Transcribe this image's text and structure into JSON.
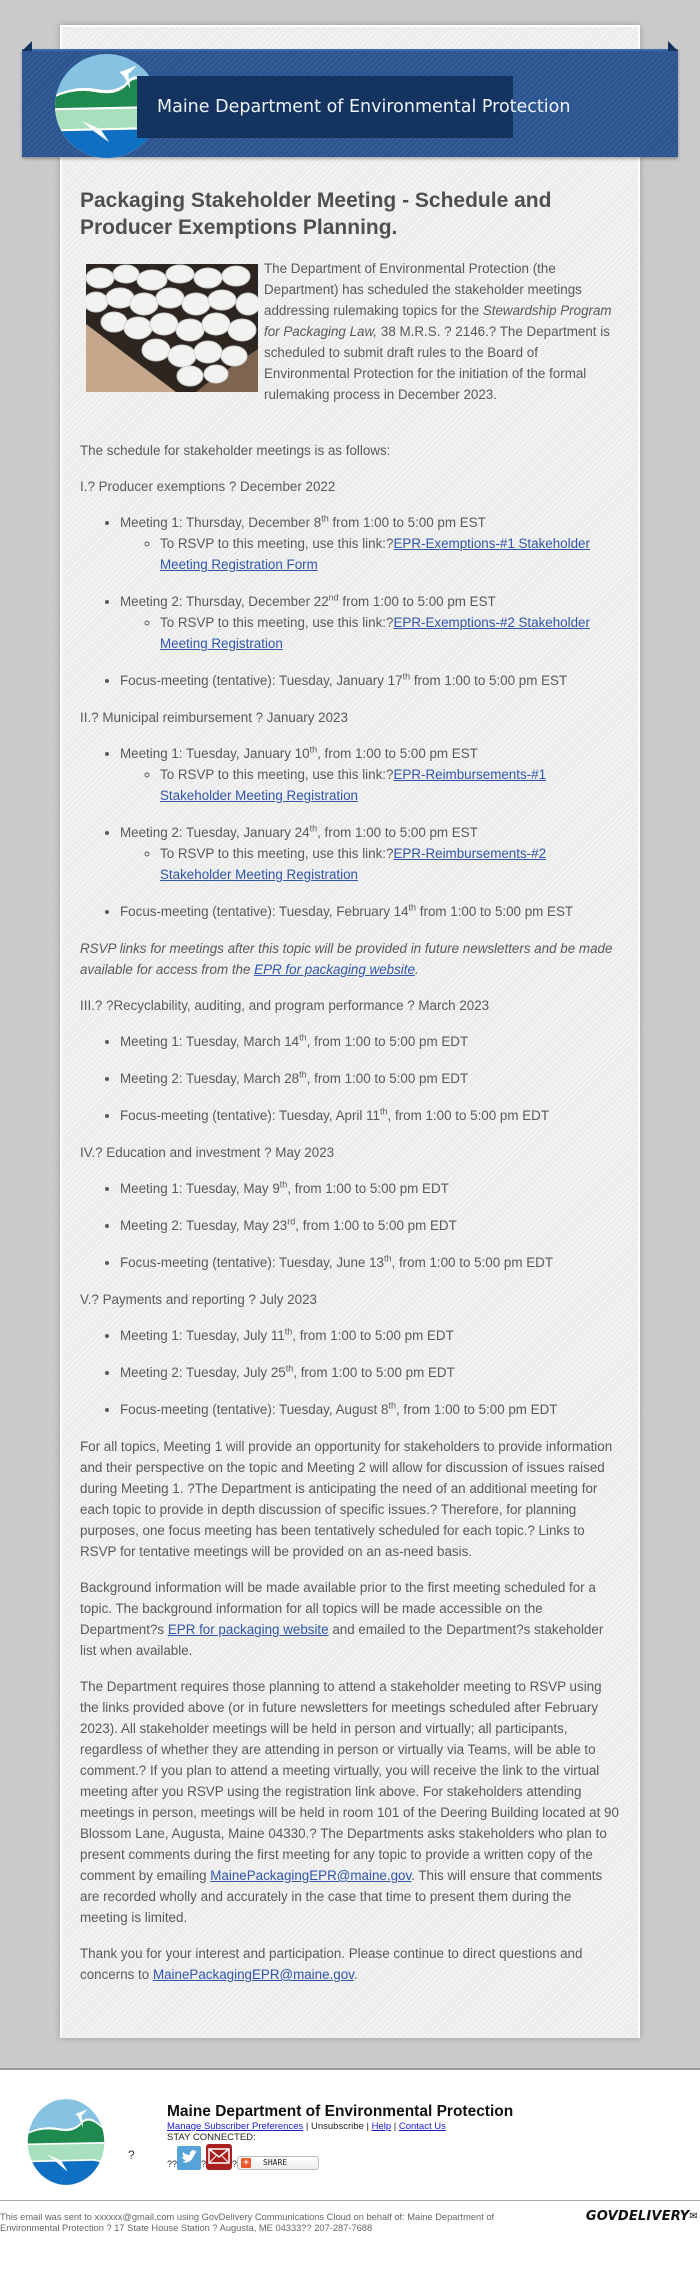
{
  "banner": {
    "title": "Maine Department of Environmental Protection",
    "logo_icon": "maine-dep-logo-icon"
  },
  "article": {
    "title": "Packaging Stakeholder Meeting - Schedule and Producer Exemptions Planning.",
    "intro_image_alt": "packing peanuts in a box",
    "intro": {
      "part1": "The Department of Environmental Protection (the Department) has scheduled the stakeholder meetings addressing rulemaking topics for the ",
      "law_italic": "Stewardship Program for Packaging Law,",
      "part2": " 38 M.R.S. ? 2146.? The Department is scheduled to submit draft rules to the Board of Environmental Protection for the initiation of the formal rulemaking process in December 2023."
    },
    "schedule_intro": "The schedule for stakeholder meetings is as follows:",
    "topics": [
      {
        "heading": "I.? Producer exemptions ? December 2022",
        "items": [
          {
            "pre": "Meeting 1: Thursday, December 8",
            "sup": "th",
            "post": " from 1:00 to 5:00 pm EST",
            "rsvp_text": "To RSVP to this meeting, use this link:?",
            "rsvp_link": "EPR-Exemptions-#1 Stakeholder Meeting Registration Form"
          },
          {
            "pre": "Meeting 2: Thursday, December 22",
            "sup": "nd",
            "post": " from 1:00 to 5:00 pm EST",
            "rsvp_text": "To RSVP to this meeting, use this link:?",
            "rsvp_link": "EPR-Exemptions-#2 Stakeholder Meeting Registration"
          },
          {
            "pre": "Focus-meeting (tentative): Tuesday, January 17",
            "sup": "th",
            "post": " from 1:00 to 5:00 pm EST"
          }
        ]
      },
      {
        "heading": "II.? Municipal reimbursement ? January 2023",
        "items": [
          {
            "pre": "Meeting 1: Tuesday, January 10",
            "sup": "th",
            "post": ", from 1:00 to 5:00 pm EST",
            "rsvp_text": "To RSVP to this meeting, use this link:?",
            "rsvp_link": "EPR-Reimbursements-#1 Stakeholder Meeting Registration"
          },
          {
            "pre": "Meeting 2: Tuesday, January 24",
            "sup": "th",
            "post": ", from 1:00 to 5:00 pm EST",
            "rsvp_text": "To RSVP to this meeting, use this link:?",
            "rsvp_link": "EPR-Reimbursements-#2 Stakeholder Meeting Registration"
          },
          {
            "pre": "Focus-meeting (tentative): Tuesday, February 14",
            "sup": "th",
            "post": " from 1:00 to 5:00 pm EST"
          }
        ]
      },
      {
        "heading": "III.? ?Recyclability, auditing, and program performance ? March 2023",
        "items": [
          {
            "pre": "Meeting 1: Tuesday, March 14",
            "sup": "th",
            "post": ", from 1:00 to 5:00 pm EDT"
          },
          {
            "pre": "Meeting 2: Tuesday, March 28",
            "sup": "th",
            "post": ", from 1:00 to 5:00 pm EDT"
          },
          {
            "pre": "Focus-meeting (tentative): Tuesday, April 11",
            "sup": "th",
            "post": ", from 1:00 to 5:00 pm EDT"
          }
        ]
      },
      {
        "heading": "IV.? Education and investment ? May 2023",
        "items": [
          {
            "pre": "Meeting 1: Tuesday, May 9",
            "sup": "th",
            "post": ", from 1:00 to 5:00 pm EDT"
          },
          {
            "pre": "Meeting 2: Tuesday, May 23",
            "sup": "rd",
            "post": ", from 1:00 to 5:00 pm EDT"
          },
          {
            "pre": "Focus-meeting (tentative): Tuesday, June 13",
            "sup": "th",
            "post": ", from 1:00 to 5:00 pm EDT"
          }
        ]
      },
      {
        "heading": "V.? Payments and reporting ? July 2023",
        "items": [
          {
            "pre": "Meeting 1: Tuesday, July 11",
            "sup": "th",
            "post": ", from 1:00 to 5:00 pm EDT"
          },
          {
            "pre": "Meeting 2: Tuesday, July 25",
            "sup": "th",
            "post": ", from 1:00 to 5:00 pm EDT"
          },
          {
            "pre": "Focus-meeting (tentative): Tuesday, August 8",
            "sup": "th",
            "post": ", from 1:00 to 5:00 pm EDT"
          }
        ]
      }
    ],
    "rsvp_note": {
      "text": "RSVP links for meetings after this topic will be provided in future newsletters and be made available for access from the ",
      "link": "EPR for packaging website",
      "end": "."
    },
    "para_all_topics": "For all topics, Meeting 1 will provide an opportunity for stakeholders to provide information and their perspective on the topic and Meeting 2 will allow for discussion of issues raised during Meeting 1. ?The Department is anticipating the need of an additional meeting for each topic to provide in depth discussion of specific issues.? Therefore, for planning purposes, one focus meeting has been tentatively scheduled for each topic.? Links to RSVP for tentative meetings will be provided on an as-need basis.",
    "para_background": {
      "text": "Background information will be made available prior to the first meeting scheduled for a topic. The background information for all topics will be made accessible on the Department?s ",
      "link": "EPR for packaging website",
      "end": " and emailed to the Department?s stakeholder list when available."
    },
    "para_requirements": {
      "text": "The Department requires those planning to attend a stakeholder meeting to RSVP using the links provided above (or in future newsletters for meetings scheduled after February 2023). All stakeholder meetings will be held in person and virtually; all participants, regardless of whether they are attending in person or virtually via Teams, will be able to comment.? If you plan to attend a meeting virtually, you will receive the link to the virtual meeting after you RSVP using the registration link above. For stakeholders attending meetings in person, meetings will be held in room 101 of the Deering Building located at 90 Blossom Lane, Augusta, Maine 04330.? The Departments asks stakeholders who plan to present comments during the first meeting for any topic to provide a written copy of the comment by emailing ",
      "link": "MainePackagingEPR@maine.gov",
      "end": ". This will ensure that comments are recorded wholly and accurately in the case that time to present them during the meeting is limited."
    },
    "para_thanks": {
      "text": "Thank you for your interest and participation. Please continue to direct questions and concerns to ",
      "link": "MainePackagingEPR@maine.gov",
      "end": "."
    }
  },
  "footer": {
    "org_name": "Maine Department of Environmental Protection",
    "logo_suffix": "?",
    "links": {
      "manage": "Manage Subscriber Preferences",
      "sep": " | ",
      "unsubscribe": "Unsubscribe",
      "help": "Help",
      "contact": "Contact Us"
    },
    "stay_connected": "STAY CONNECTED:",
    "social": {
      "prefix": "??",
      "between1": "?",
      "between2": "?",
      "twitter_icon": "twitter-icon",
      "email_icon": "email-icon",
      "share_label": "SHARE"
    }
  },
  "bottom": {
    "disclaimer": "This email was sent to xxxxxx@gmail.com using GovDelivery Communications Cloud on behalf of: Maine Department of Environmental Protection ? 17 State House Station ? Augusta, ME 04333?? 207-287-7688",
    "brand": "GOVDELIVERY"
  }
}
